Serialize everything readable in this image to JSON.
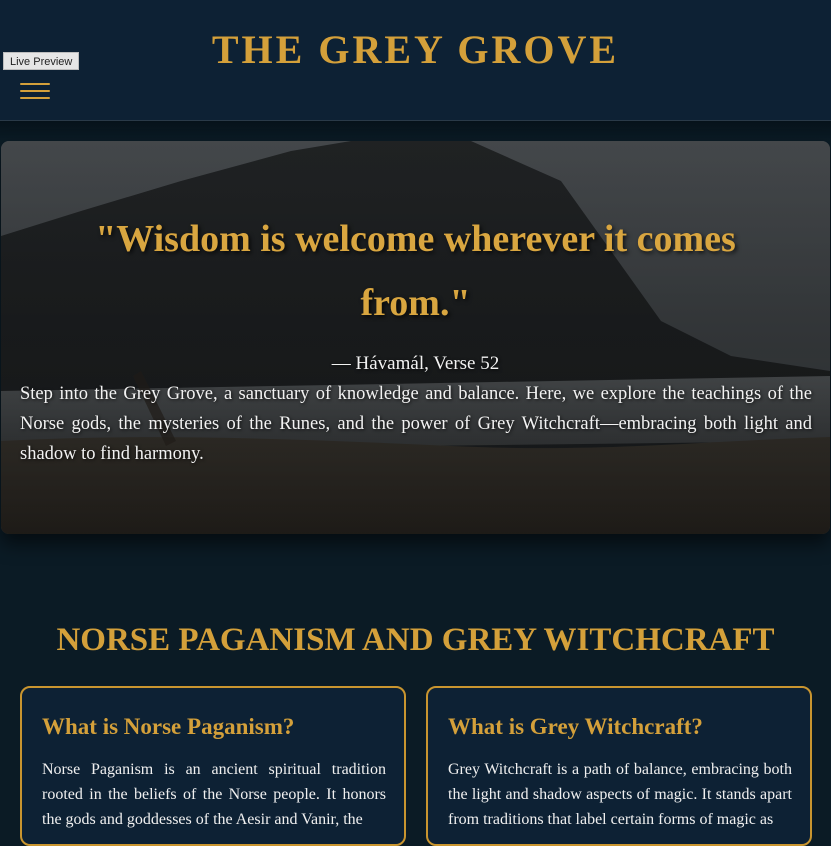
{
  "header": {
    "title": "THE GREY GROVE",
    "live_preview_label": "Live Preview",
    "menu_icon": "hamburger-menu-icon"
  },
  "hero": {
    "quote": "\"Wisdom is welcome wherever it comes from.\"",
    "citation": "— Hávamál, Verse 52",
    "intro": "Step into the Grey Grove, a sanctuary of knowledge and balance. Here, we explore the teachings of the Norse gods, the mysteries of the Runes, and the power of Grey Witchcraft—embracing both light and shadow to find harmony."
  },
  "section": {
    "title": "NORSE PAGANISM AND GREY WITCHCRAFT",
    "cards": [
      {
        "title": "What is Norse Paganism?",
        "text": "Norse Paganism is an ancient spiritual tradition rooted in the beliefs of the Norse people. It honors the gods and goddesses of the Aesir and Vanir, the"
      },
      {
        "title": "What is Grey Witchcraft?",
        "text": "Grey Witchcraft is a path of balance, embracing both the light and shadow aspects of magic. It stands apart from traditions that label certain forms of magic as"
      }
    ]
  },
  "colors": {
    "accent_gold": "#d4a03a",
    "header_bg": "#0d2134",
    "page_bg": "#0b1b25",
    "body_text": "#f0f0f0"
  }
}
